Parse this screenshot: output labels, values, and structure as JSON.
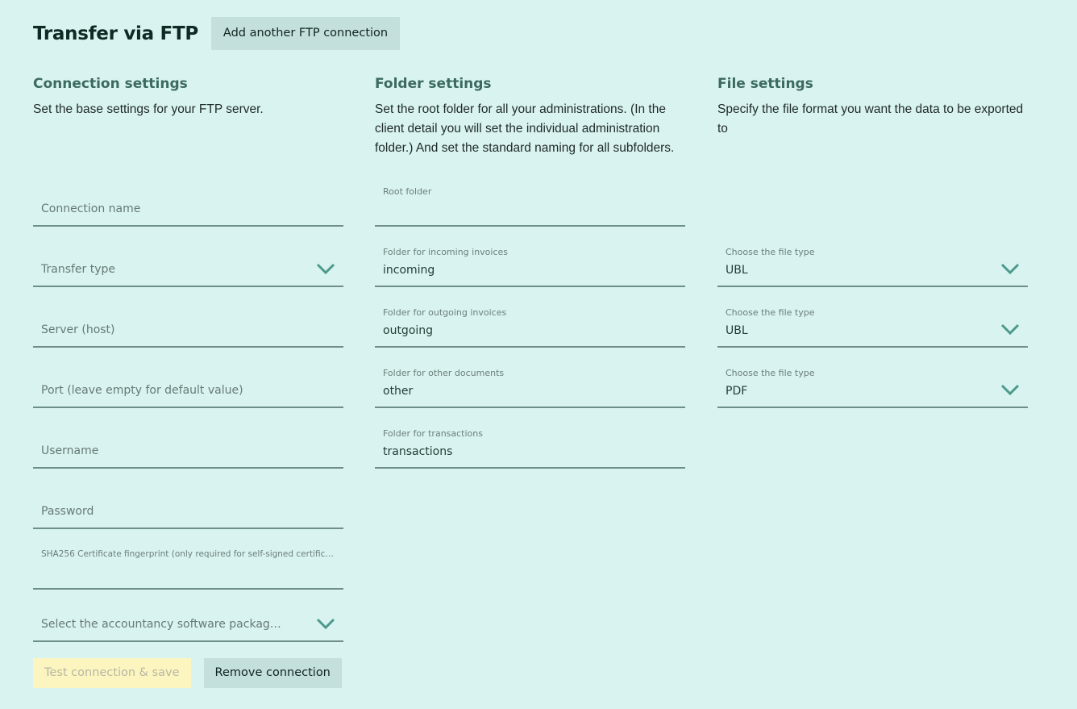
{
  "header": {
    "title": "Transfer via FTP",
    "add_button": "Add another FTP connection"
  },
  "connection": {
    "title": "Connection settings",
    "description": "Set the base settings for your FTP server.",
    "fields": {
      "connection_name": "Connection name",
      "transfer_type": "Transfer type",
      "server": "Server (host)",
      "port": "Port (leave empty for default value)",
      "username": "Username",
      "password": "Password",
      "fingerprint": "SHA256 Certificate fingerprint (only required for self-signed certific…",
      "software": "Select the accountancy software packag…"
    }
  },
  "folders": {
    "title": "Folder settings",
    "description": "Set the root folder for all your administrations. (In the client detail you will set the individual administration folder.) And set the standard naming for all subfolders.",
    "root_label": "Root folder",
    "incoming_label": "Folder for incoming invoices",
    "incoming_value": "incoming",
    "outgoing_label": "Folder for outgoing invoices",
    "outgoing_value": "outgoing",
    "other_label": "Folder for other documents",
    "other_value": "other",
    "transactions_label": "Folder for transactions",
    "transactions_value": "transactions"
  },
  "files": {
    "title": "File settings",
    "description": "Specify the file format you want the data to be exported to",
    "type_label": "Choose the file type",
    "incoming_type": "UBL",
    "outgoing_type": "UBL",
    "other_type": "PDF"
  },
  "actions": {
    "test_save": "Test connection & save",
    "remove": "Remove connection"
  },
  "colors": {
    "background": "#d9f3f0",
    "button": "#c3e0dc",
    "accent_chevron": "#4d9a8c",
    "disabled_button": "#fdf5bf"
  }
}
